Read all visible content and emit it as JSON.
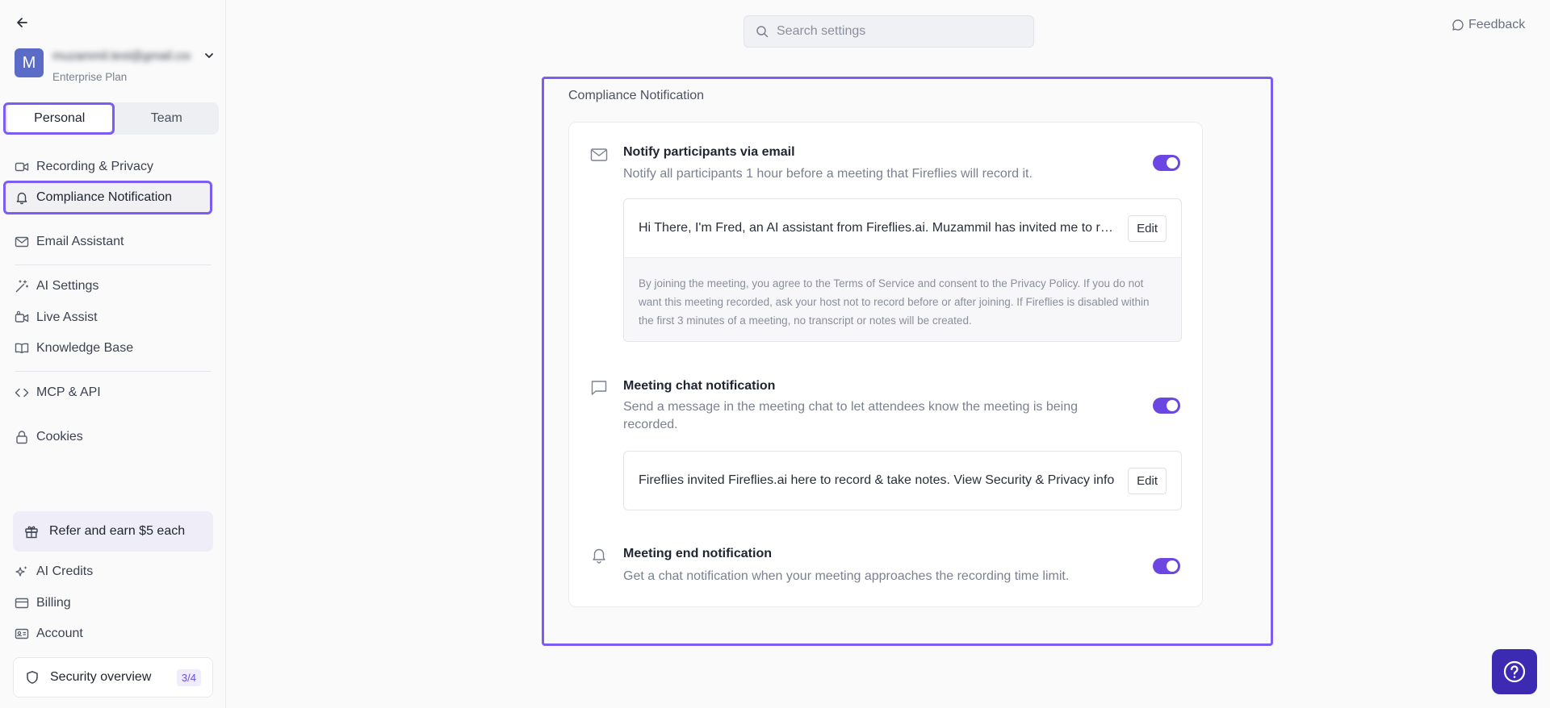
{
  "user": {
    "avatar_letter": "M",
    "email": "muzammil.test@gmail.com",
    "plan": "Enterprise Plan"
  },
  "segments": {
    "personal": "Personal",
    "team": "Team"
  },
  "nav": {
    "recording_privacy": "Recording & Privacy",
    "compliance_notification": "Compliance Notification",
    "email_assistant": "Email Assistant",
    "ai_settings": "AI Settings",
    "live_assist": "Live Assist",
    "knowledge_base": "Knowledge Base",
    "mcp_api": "MCP & API",
    "cookies": "Cookies",
    "ai_credits": "AI Credits",
    "billing": "Billing",
    "account": "Account"
  },
  "refer": {
    "label": "Refer and earn $5 each"
  },
  "security": {
    "label": "Security overview",
    "badge": "3/4"
  },
  "search": {
    "placeholder": "Search settings"
  },
  "feedback": {
    "label": "Feedback"
  },
  "section": {
    "title": "Compliance Notification"
  },
  "options": {
    "email": {
      "title": "Notify participants via email",
      "description": "Notify all participants 1 hour before a meeting that Fireflies will record it.",
      "enabled": true,
      "message": "Hi There, I'm Fred, an AI assistant from Fireflies.ai. Muzammil has invited me to record and take notes for this meeting.",
      "edit_label": "Edit",
      "footer": "By joining the meeting, you agree to the Terms of Service and consent to the Privacy Policy. If you do not want this meeting recorded, ask your host not to record before or after joining. If Fireflies is disabled within the first 3 minutes of a meeting, no transcript or notes will be created."
    },
    "chat": {
      "title": "Meeting chat notification",
      "description": "Send a message in the meeting chat to let attendees know the meeting is being recorded.",
      "enabled": true,
      "message": "Fireflies invited Fireflies.ai here to record & take notes. View Security & Privacy info",
      "edit_label": "Edit"
    },
    "end": {
      "title": "Meeting end notification",
      "description": "Get a chat notification when your meeting approaches the recording time limit.",
      "enabled": true
    }
  },
  "colors": {
    "accent": "#6b46e0",
    "highlight": "#7c5cf3",
    "avatar": "#5b6bc8",
    "help": "#3c2ab2"
  },
  "icons": {
    "back": "arrow-left-icon",
    "search": "search-icon",
    "feedback": "chat-bubble-icon",
    "help": "help-circle-icon"
  }
}
